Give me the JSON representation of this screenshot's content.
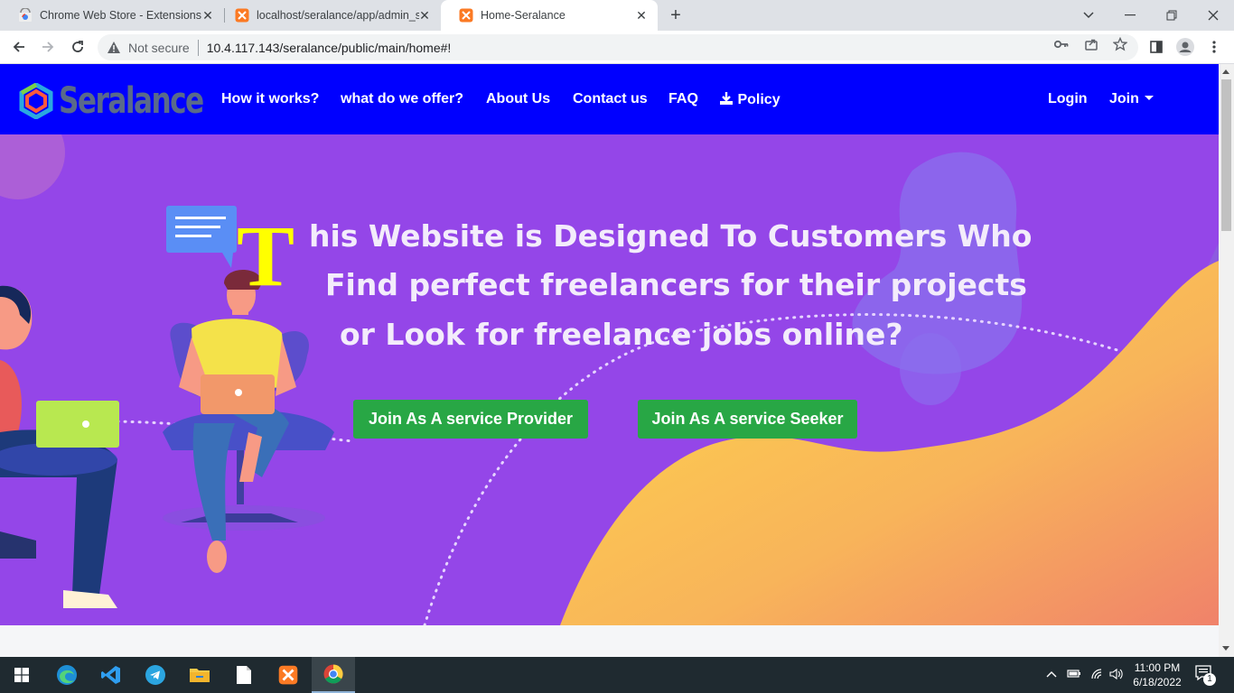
{
  "browser": {
    "tabs": [
      {
        "title": "Chrome Web Store - Extensions",
        "icon": "chrome-web-store-icon",
        "active": false
      },
      {
        "title": "localhost/seralance/app/admin_s",
        "icon": "xampp-icon",
        "active": false
      },
      {
        "title": "Home-Seralance",
        "icon": "xampp-icon",
        "active": true
      }
    ],
    "security_label": "Not secure",
    "url": "10.4.117.143/seralance/public/main/home#!"
  },
  "site": {
    "logo_text": "Seralance",
    "nav": {
      "how": "How it works?",
      "offer": "what do we offer?",
      "about": "About Us",
      "contact": "Contact us",
      "faq": "FAQ",
      "policy": "Policy",
      "login": "Login",
      "join": "Join"
    },
    "hero": {
      "initial": "T",
      "line1": "his Website is Designed To Customers Who",
      "line2": "Find perfect freelancers for their projects",
      "line3": "or Look for freelance jobs online?",
      "btn_provider": "Join As A service Provider",
      "btn_seeker": "Join As A service Seeker"
    },
    "colors": {
      "navbar": "#0000ff",
      "hero": "#9446e8",
      "button": "#28a745",
      "initial": "#ffff00"
    }
  },
  "taskbar": {
    "apps": [
      "windows-start-icon",
      "edge-icon",
      "vscode-icon",
      "telegram-icon",
      "file-explorer-icon",
      "notepad-icon",
      "xampp-icon",
      "chrome-icon"
    ],
    "time": "11:00 PM",
    "date": "6/18/2022",
    "notification_count": "1"
  }
}
